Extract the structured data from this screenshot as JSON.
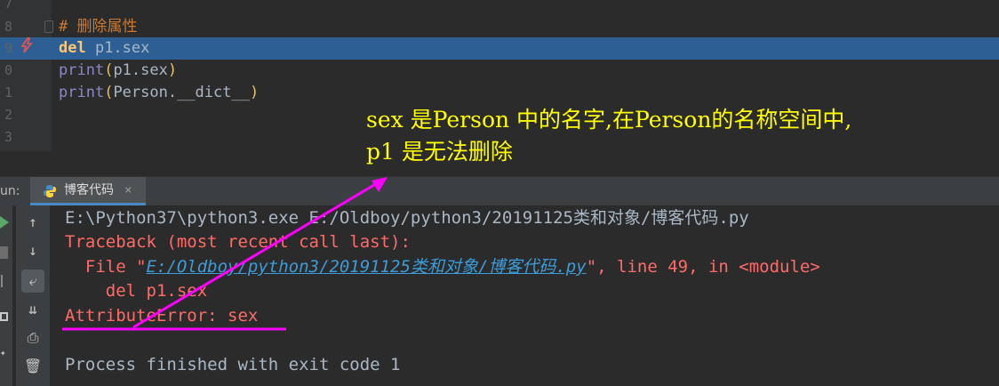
{
  "editor": {
    "lines": [
      {
        "num": "7"
      },
      {
        "num": "8",
        "comment": "# 删除属性"
      },
      {
        "num": "9",
        "kw": "del",
        "rest": " p1.sex",
        "highlighted": true
      },
      {
        "num": "0",
        "fn": "print",
        "open": "(",
        "arg": "p1.sex",
        "close": ")"
      },
      {
        "num": "1",
        "fn": "print",
        "open": "(",
        "arg": "Person.__dict__",
        "close": ")"
      },
      {
        "num": "2"
      },
      {
        "num": "3"
      }
    ],
    "breakpoint_icon": "lightning-icon"
  },
  "annotation": {
    "line1": "sex 是Person 中的名字,在Person的名称空间中,",
    "line2": "p1 是无法删除",
    "color": "#ffff00"
  },
  "run_panel": {
    "label": "un:",
    "tab": {
      "label": "博客代码",
      "close": "×",
      "icon": "python-icon"
    }
  },
  "toolbar": {
    "icons": [
      "rerun-icon",
      "up-arrow-icon",
      "stop-icon",
      "down-arrow-icon",
      "soft-wrap-icon",
      "layout-icon",
      "scroll-to-end-icon",
      "pin-icon",
      "print-icon",
      "trash-icon"
    ]
  },
  "console": {
    "cmd": "E:\\Python37\\python3.exe E:/Oldboy/python3/20191125类和对象/博客代码.py",
    "traceback": "Traceback (most recent call last):",
    "file_prefix": "  File \"",
    "file_link": "E:/Oldboy/python3/20191125类和对象/博客代码.py",
    "file_suffix": "\", line 49, in <module>",
    "code_line": "    del p1.sex",
    "error": "AttributeError: sex",
    "finished": "Process finished with exit code 1"
  },
  "markup": {
    "color": "#ff00ff"
  }
}
